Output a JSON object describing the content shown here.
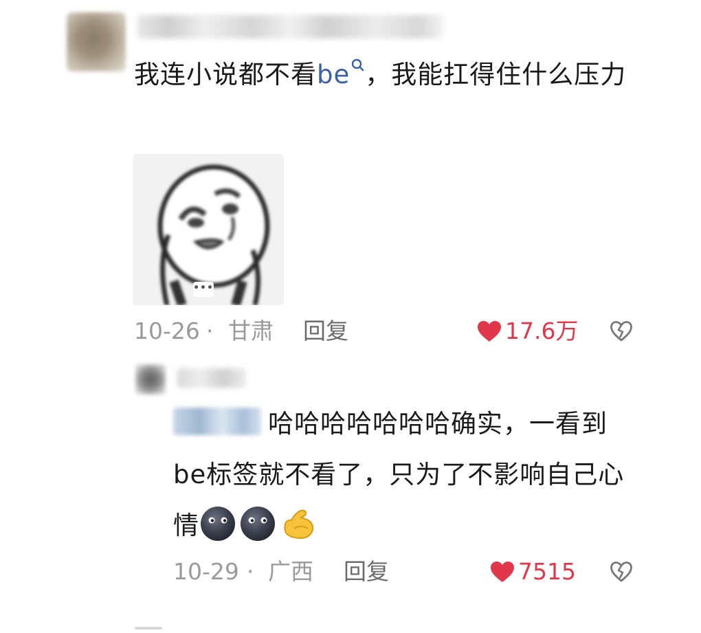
{
  "main_comment": {
    "text_before": "我连小说都不看",
    "highlight": "be",
    "text_after": "，我能扛得住什么压力",
    "date": "10-26",
    "separator": "·",
    "location": "甘肃",
    "reply_label": "回复",
    "like_count": "17.6万",
    "sticker_badge": "•••"
  },
  "reply_comment": {
    "text": "哈哈哈哈哈哈哈确实，一看到be标签就不看了，只为了不影响自己心情",
    "emojis": [
      "moon-face-emoji",
      "moon-face-emoji",
      "flexed-biceps-emoji"
    ],
    "date": "10-29",
    "separator": "·",
    "location": "广西",
    "reply_label": "回复",
    "like_count": "7515"
  },
  "colors": {
    "like_red": "#e2364b",
    "link_blue": "#3a61a8",
    "meta_gray": "#9a9a9a"
  },
  "icons": [
    "search-icon",
    "heart-icon",
    "dislike-heart-icon"
  ]
}
